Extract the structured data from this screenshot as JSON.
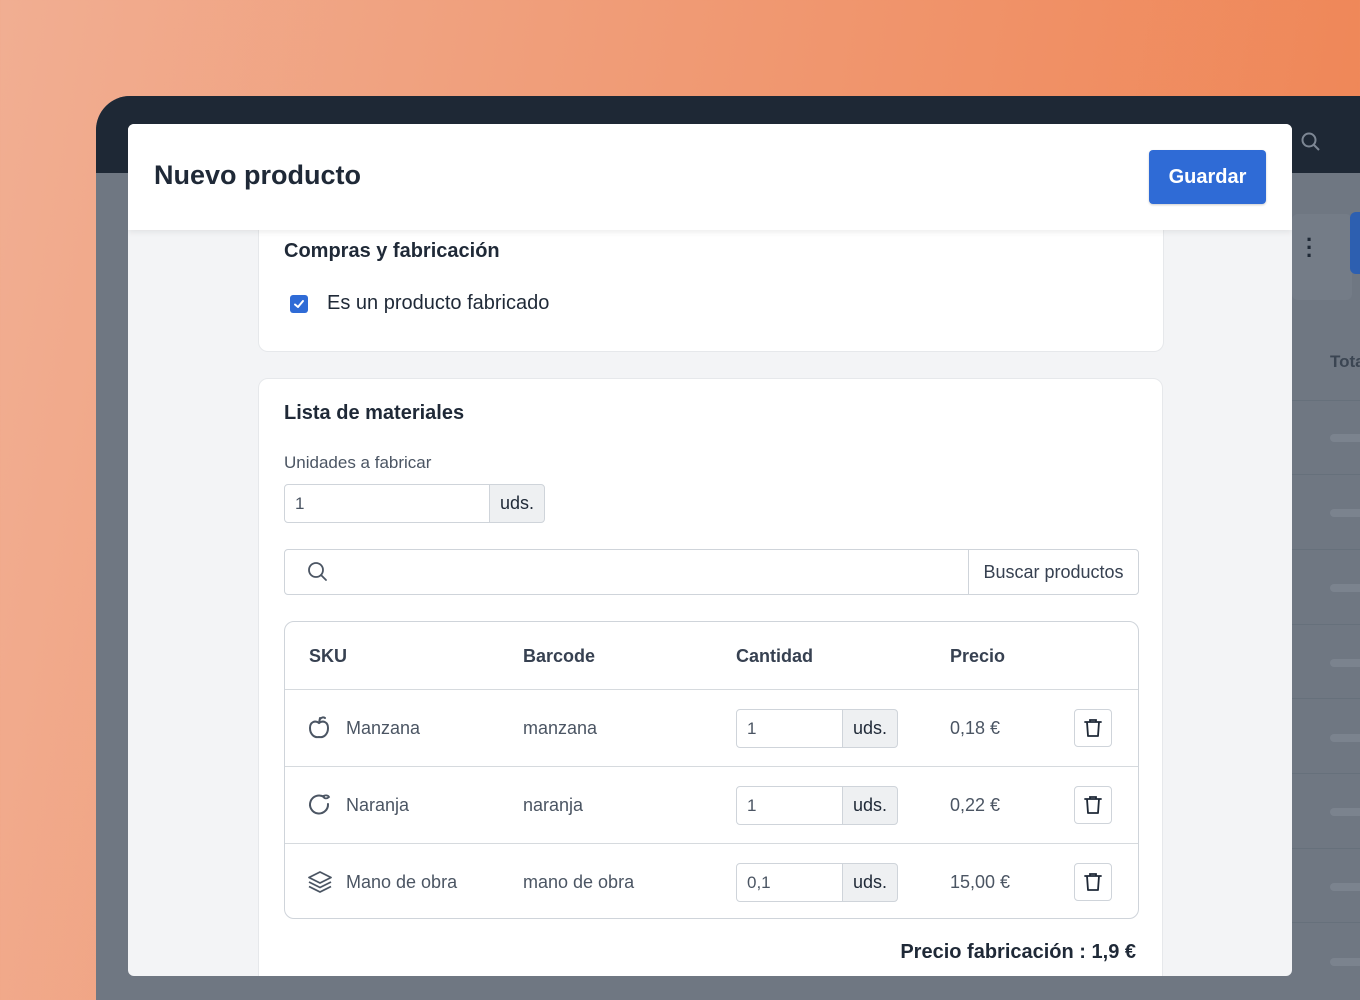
{
  "modal": {
    "title": "Nuevo producto",
    "save_label": "Guardar"
  },
  "purchasing": {
    "title": "Compras y fabricación",
    "manufactured_label": "Es un producto fabricado",
    "manufactured_checked": true
  },
  "bom": {
    "title": "Lista de materiales",
    "units_label": "Unidades a fabricar",
    "units_value": "1",
    "units_suffix": "uds.",
    "search_placeholder": "",
    "search_button": "Buscar productos",
    "columns": [
      "SKU",
      "Barcode",
      "Cantidad",
      "Precio"
    ],
    "rows": [
      {
        "icon": "apple-icon",
        "sku": "Manzana",
        "barcode": "manzana",
        "qty": "1",
        "unit": "uds.",
        "price": "0,18 €"
      },
      {
        "icon": "orange-icon",
        "sku": "Naranja",
        "barcode": "naranja",
        "qty": "1",
        "unit": "uds.",
        "price": "0,22 €"
      },
      {
        "icon": "layers-icon",
        "sku": "Mano de obra",
        "barcode": "mano de obra",
        "qty": "0,1",
        "unit": "uds.",
        "price": "15,00 €"
      }
    ],
    "total_label": "Precio fabricación : 1,9 €"
  },
  "background": {
    "column_label": "Tota"
  },
  "colors": {
    "accent": "#2f6bd6",
    "topbar": "#1e2835"
  }
}
